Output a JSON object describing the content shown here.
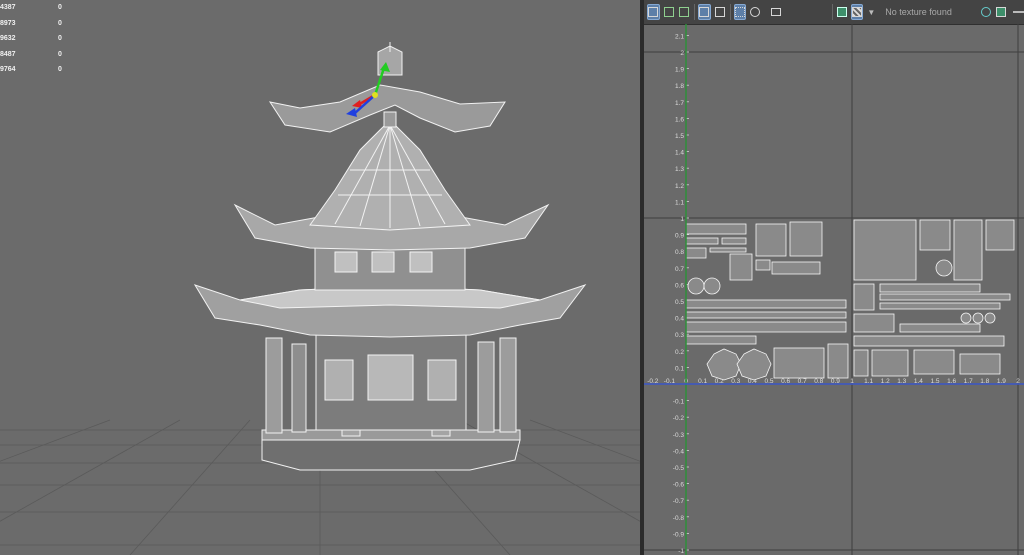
{
  "stats": [
    {
      "value": "4387",
      "count": "0"
    },
    {
      "value": "8973",
      "count": "0"
    },
    {
      "value": "9632",
      "count": "0"
    },
    {
      "value": "8487",
      "count": "0"
    },
    {
      "value": "9764",
      "count": "0"
    }
  ],
  "uv_editor": {
    "texture_status": "No texture found",
    "v_labels": [
      "2.1",
      "2",
      "1.9",
      "1.8",
      "1.7",
      "1.6",
      "1.5",
      "1.4",
      "1.3",
      "1.2",
      "1.1",
      "1",
      "0.9",
      "0.8",
      "0.7",
      "0.6",
      "0.5",
      "0.4",
      "0.3",
      "0.2",
      "0.1",
      "-0.1",
      "-0.2",
      "-0.3",
      "-0.4",
      "-0.5",
      "-0.6",
      "-0.7",
      "-0.8",
      "-0.9",
      "-1"
    ],
    "u_labels": [
      "-0.2",
      "-0.1",
      "0",
      "0.1",
      "0.2",
      "0.3",
      "0.4",
      "0.5",
      "0.6",
      "0.7",
      "0.8",
      "0.9",
      "1",
      "1.1",
      "1.2",
      "1.3",
      "1.4",
      "1.5",
      "1.6",
      "1.7",
      "1.8",
      "1.9",
      "2"
    ]
  },
  "colors": {
    "viewport_bg": "#6b6b6b",
    "uv_bg": "#6a6a6a",
    "toolbar_bg": "#444444",
    "axis_u": "#3b56c8",
    "axis_v": "#2e8f3a",
    "active_button": "#5d7fa8"
  },
  "icons": [
    "uv-shell-icon",
    "uv-select-icon",
    "uv-move-icon",
    "uv-frame-icon",
    "uv-grid-icon",
    "uv-sun-icon",
    "uv-snapshot-icon",
    "texture-icon",
    "checker-icon",
    "dropdown-arrow-icon",
    "refresh-icon",
    "close-icon"
  ]
}
